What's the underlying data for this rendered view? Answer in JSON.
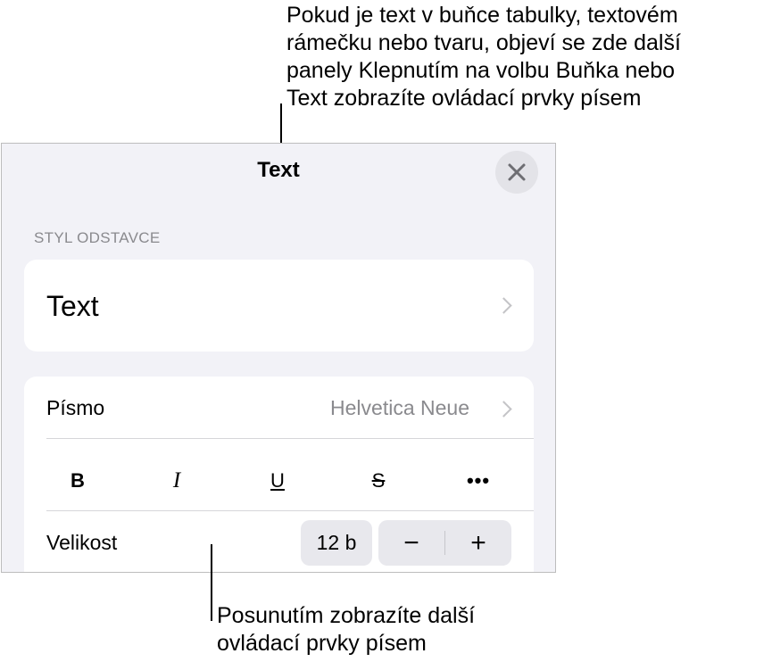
{
  "callouts": {
    "top": "Pokud je text v buňce tabulky, textovém\nrámečku nebo tvaru, objeví se zde další\npanely Klepnutím na volbu Buňka nebo\nText zobrazíte ovládací prvky písem",
    "bottom": "Posunutím zobrazíte další\novládací prvky písem"
  },
  "panel": {
    "title": "Text",
    "close_icon": "close-icon"
  },
  "paragraph_style": {
    "section_header": "STYL ODSTAVCE",
    "value": "Text"
  },
  "font": {
    "label": "Písmo",
    "value": "Helvetica Neue"
  },
  "formatting": {
    "bold": "B",
    "italic": "I",
    "underline": "U",
    "strikethrough": "S",
    "more": "•••"
  },
  "size": {
    "label": "Velikost",
    "value": "12 b",
    "decrease": "−",
    "increase": "+"
  },
  "colors": {
    "panel_background": "#f2f2f7",
    "secondary_text": "#8a8a8e"
  }
}
